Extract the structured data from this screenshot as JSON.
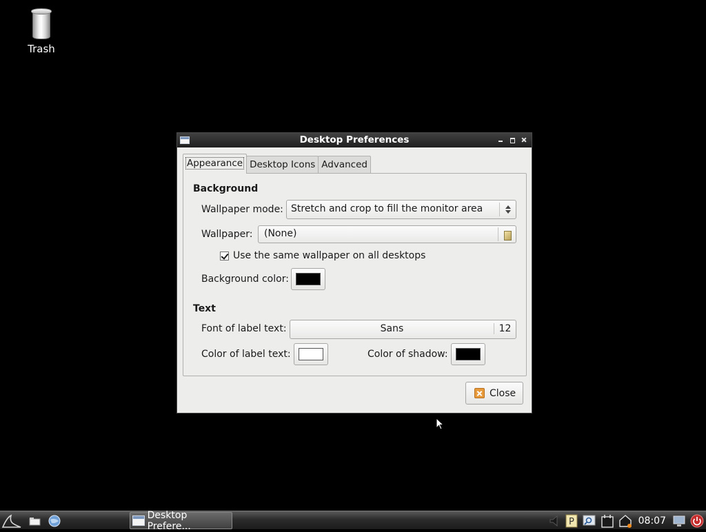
{
  "desktop": {
    "icons": [
      {
        "label": "Trash",
        "icon": "trash-icon"
      }
    ]
  },
  "window": {
    "title": "Desktop Preferences",
    "tabs": [
      {
        "label": "Appearance",
        "active": true
      },
      {
        "label": "Desktop Icons",
        "active": false
      },
      {
        "label": "Advanced",
        "active": false
      }
    ],
    "background": {
      "heading": "Background",
      "wallpaper_mode_label": "Wallpaper mode:",
      "wallpaper_mode_value": "Stretch and crop to fill the monitor area",
      "wallpaper_label": "Wallpaper:",
      "wallpaper_value": "(None)",
      "same_wallpaper_label": "Use the same wallpaper on all desktops",
      "same_wallpaper_checked": true,
      "bg_color_label": "Background color:",
      "bg_color": "#000000"
    },
    "text": {
      "heading": "Text",
      "font_label": "Font of label text:",
      "font_name": "Sans",
      "font_size": "12",
      "label_color_label": "Color of label text:",
      "label_color": "#ffffff",
      "shadow_color_label": "Color of shadow:",
      "shadow_color": "#000000"
    },
    "close_label": "Close"
  },
  "taskbar": {
    "task_label": "Desktop Prefere...",
    "clock": "08:07",
    "left_icons": [
      "start-menu-icon",
      "file-manager-icon",
      "browser-icon"
    ],
    "tray_icons": [
      "volume-icon",
      "pidgin-icon",
      "search-icon",
      "calendar-icon",
      "network-icon",
      "screen-icon",
      "power-icon"
    ]
  }
}
